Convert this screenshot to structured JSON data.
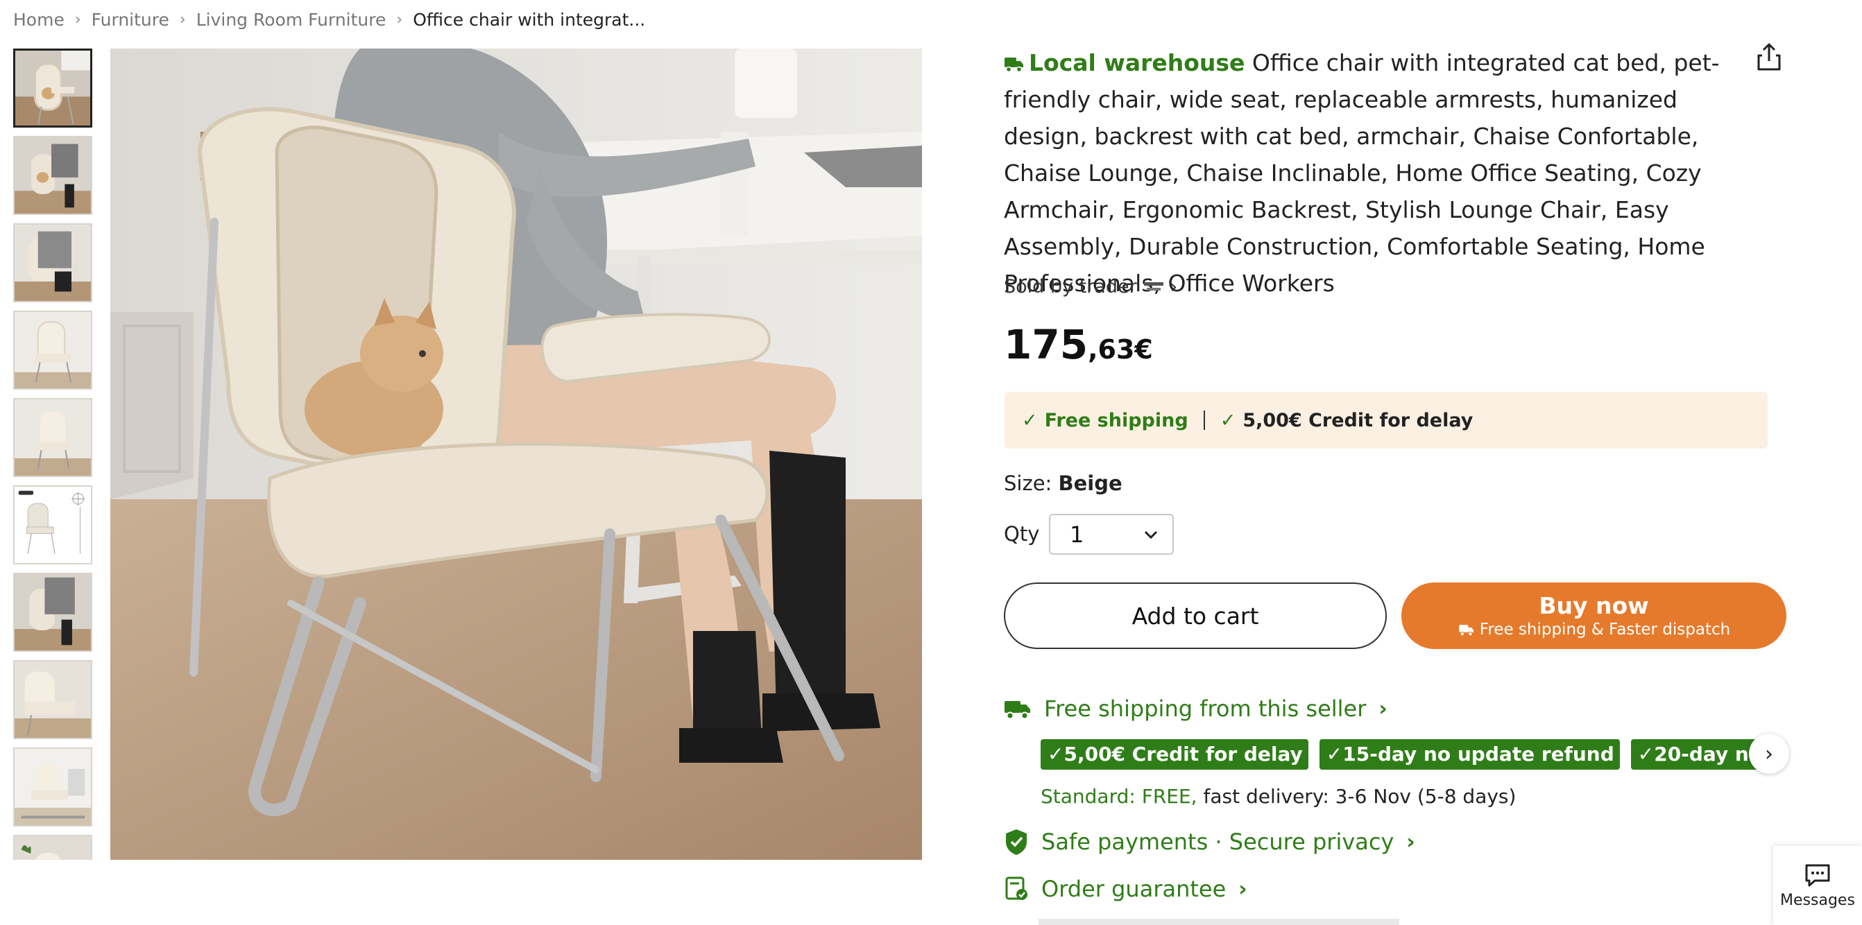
{
  "breadcrumb": {
    "items": [
      "Home",
      "Furniture",
      "Living Room Furniture",
      "Office chair with integrat..."
    ]
  },
  "gallery": {
    "thumbnail_count": 10,
    "selected_index": 0
  },
  "product": {
    "badge": "Local warehouse",
    "title": "Office chair with integrated cat bed, pet-friendly chair, wide seat, replaceable armrests, humanized design, backrest with cat bed, armchair, Chaise Confortable, Chaise Lounge, Chaise Inclinable, Home Office Seating, Cozy Armchair, Ergonomic Backrest, Stylish Lounge Chair, Easy Assembly, Durable Construction, Comfortable Seating, Home Professionals, Office Workers",
    "seller_prefix": "Sold by trader",
    "seller_logo_text": "YOPINE CO.LTD",
    "price_main": "175",
    "price_cents": ",63€"
  },
  "shipping_box": {
    "free_shipping": "Free shipping",
    "credit": "5,00€ Credit for delay"
  },
  "size": {
    "label": "Size:",
    "value": "Beige"
  },
  "quantity": {
    "label": "Qty",
    "value": "1"
  },
  "actions": {
    "add_to_cart": "Add to cart",
    "buy_now": "Buy now",
    "buy_now_sub": "Free shipping & Faster dispatch"
  },
  "seller_shipping": {
    "title": "Free shipping from this seller",
    "tags": [
      "5,00€ Credit for delay",
      "15-day no update refund",
      "20-day no delivery refund"
    ],
    "standard": "Standard: FREE,",
    "fast": "fast delivery: 3-6 Nov (5-8 days)"
  },
  "safe_payments": "Safe payments · Secure privacy",
  "order_guarantee": "Order guarantee",
  "messages": "Messages",
  "colors": {
    "accent_green": "#2f7d18",
    "buy_orange": "#e67a2c",
    "shipping_box_bg": "#fbf0e2"
  },
  "icons": [
    "share-icon",
    "truck-icon",
    "check-icon",
    "chevron-down-icon",
    "chevron-right-icon",
    "shield-check-icon",
    "order-guarantee-icon",
    "chat-icon"
  ]
}
